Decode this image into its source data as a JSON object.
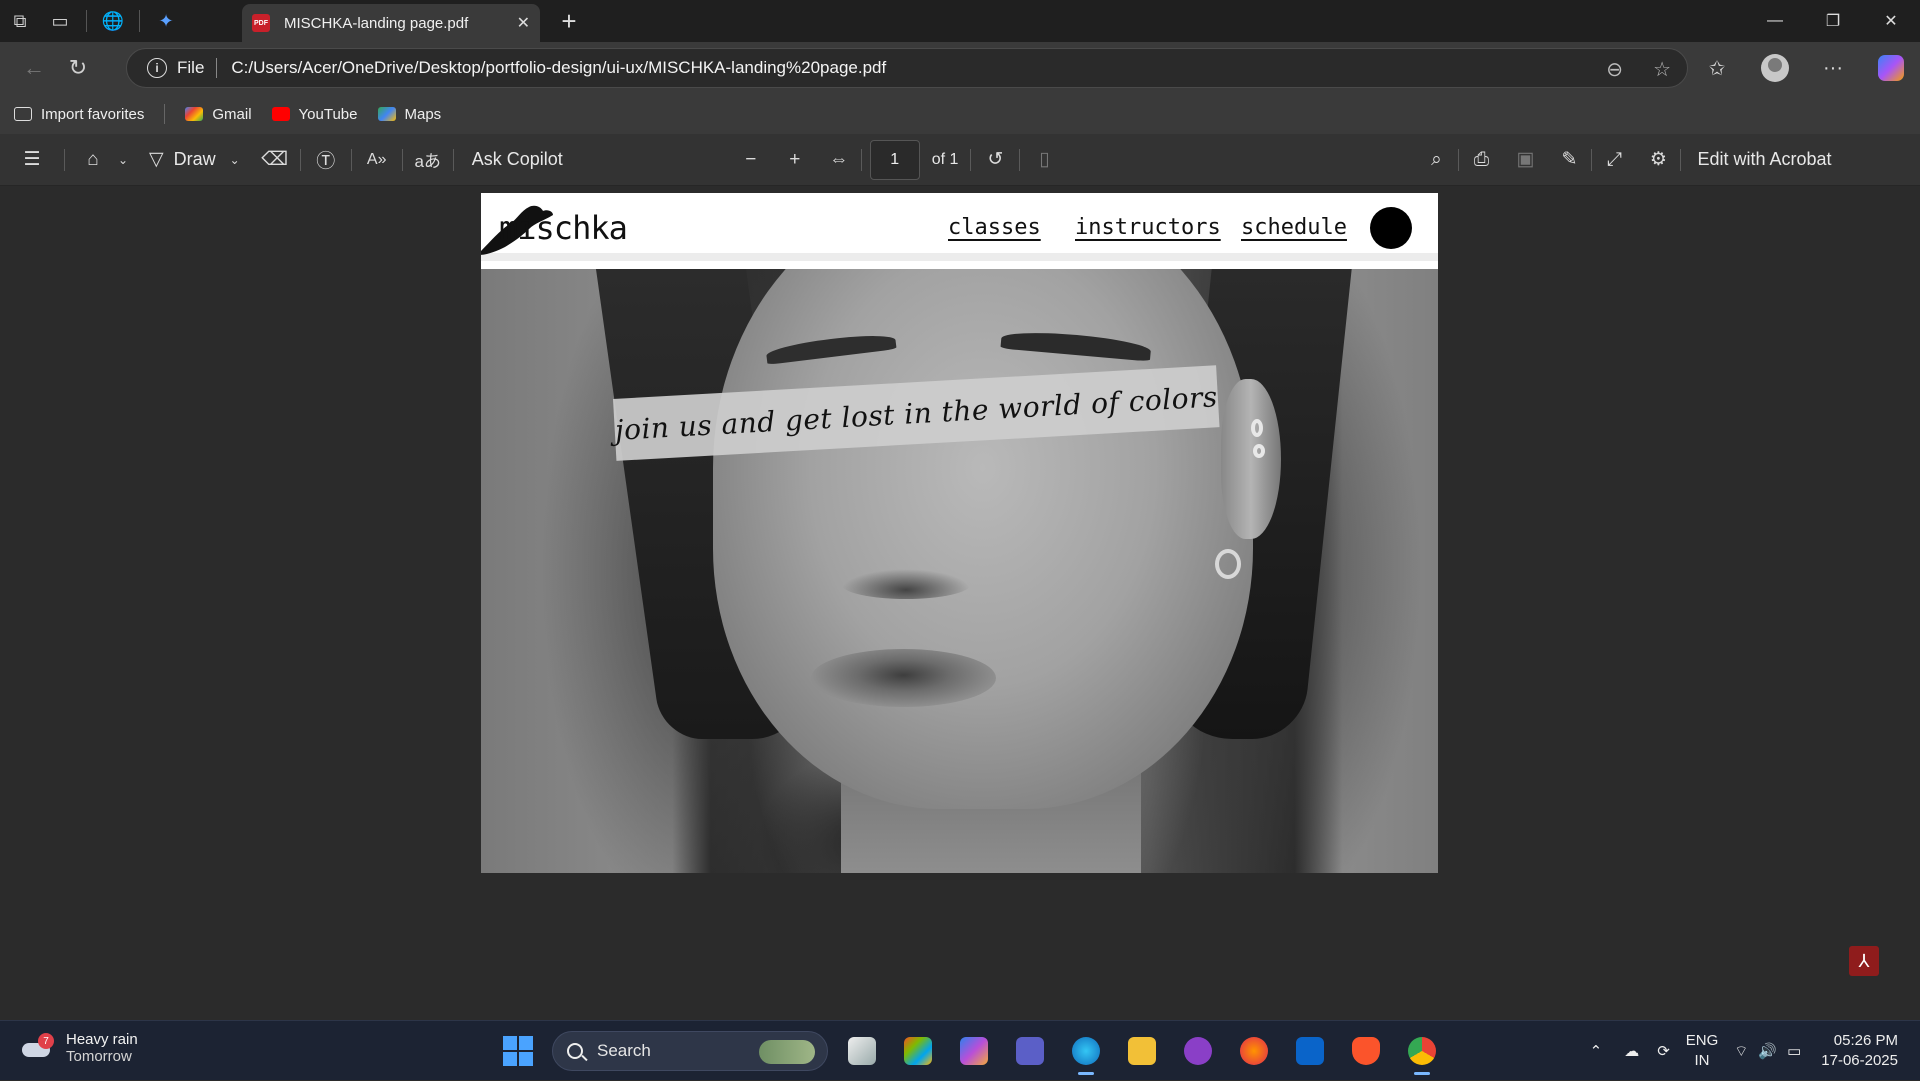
{
  "browser": {
    "tab_title": "MISCHKA-landing page.pdf",
    "tab_icon_text": "PDF",
    "address": {
      "scheme_label": "File",
      "url": "C:/Users/Acer/OneDrive/Desktop/portfolio-design/ui-ux/MISCHKA-landing%20page.pdf"
    },
    "favorites": [
      {
        "label": "Import favorites",
        "icon": "import-favorites-icon"
      },
      {
        "label": "Gmail",
        "icon": "gmail-icon",
        "color": "#ea4335"
      },
      {
        "label": "YouTube",
        "icon": "youtube-icon",
        "color": "#ff0000"
      },
      {
        "label": "Maps",
        "icon": "maps-icon",
        "color": "#34a853"
      }
    ]
  },
  "pdf_toolbar": {
    "draw_label": "Draw",
    "ask_copilot_label": "Ask Copilot",
    "page_number": "1",
    "page_total": "of 1",
    "edit_acrobat_label": "Edit with Acrobat"
  },
  "document": {
    "logo_text": "mischka",
    "nav": [
      "classes",
      "instructors",
      "schedule"
    ],
    "banner_text": "join us and get lost in the world of colors"
  },
  "taskbar": {
    "weather": {
      "condition": "Heavy rain",
      "when": "Tomorrow",
      "badge": "7"
    },
    "search_label": "Search",
    "language": {
      "line1": "ENG",
      "line2": "IN"
    },
    "time": "05:26 PM",
    "date": "17-06-2025"
  },
  "colors": {
    "browser_chrome": "#3a3a3a",
    "pdf_canvas": "#2b2b2b",
    "taskbar": "#1c2333",
    "accent": "#4aa3ff"
  }
}
